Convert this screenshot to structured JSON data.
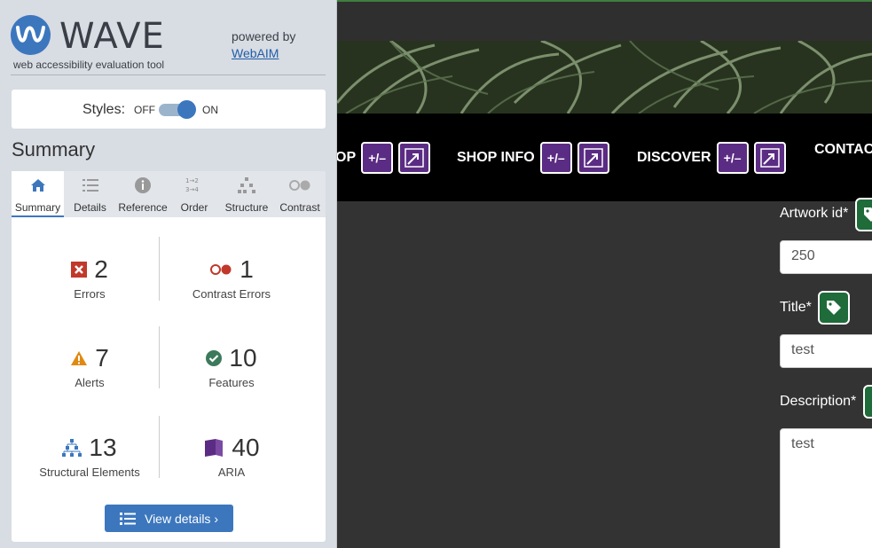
{
  "wave": {
    "title": "WAVE",
    "tagline": "web accessibility evaluation tool",
    "powered_by": "powered by",
    "powered_link": "WebAIM",
    "styles_label": "Styles:",
    "styles_off": "OFF",
    "styles_on": "ON",
    "styles_state": "on",
    "summary_heading": "Summary",
    "tabs": [
      {
        "label": "Summary",
        "icon": "home-icon",
        "active": true
      },
      {
        "label": "Details",
        "icon": "list-icon",
        "active": false
      },
      {
        "label": "Reference",
        "icon": "info-icon",
        "active": false
      },
      {
        "label": "Order",
        "icon": "order-icon",
        "active": false
      },
      {
        "label": "Structure",
        "icon": "structure-icon",
        "active": false
      },
      {
        "label": "Contrast",
        "icon": "contrast-icon",
        "active": false
      }
    ],
    "summary": [
      {
        "count": "2",
        "label": "Errors",
        "icon": "error-icon",
        "color": "#c0392b"
      },
      {
        "count": "1",
        "label": "Contrast Errors",
        "icon": "contrast-error-icon",
        "color": "#c0392b"
      },
      {
        "count": "7",
        "label": "Alerts",
        "icon": "alert-icon",
        "color": "#e08a12"
      },
      {
        "count": "10",
        "label": "Features",
        "icon": "feature-icon",
        "color": "#3d7a5c"
      },
      {
        "count": "13",
        "label": "Structural Elements",
        "icon": "structure-icon",
        "color": "#3c77be"
      },
      {
        "count": "40",
        "label": "ARIA",
        "icon": "aria-icon",
        "color": "#5b2c83"
      }
    ],
    "view_details": "View details ›"
  },
  "page": {
    "nav": [
      "OP",
      "SHOP INFO",
      "DISCOVER",
      "CONTAC"
    ],
    "badges": {
      "toggle": "+/–"
    },
    "form": {
      "artwork_label": "Artwork id*",
      "artwork_value": "250",
      "title_label": "Title*",
      "title_value": "test",
      "description_label": "Description*",
      "description_value": "test"
    }
  },
  "colors": {
    "accent": "#3c77be",
    "aria_purple": "#5b2c83",
    "tag_green": "#1f6b3a"
  }
}
